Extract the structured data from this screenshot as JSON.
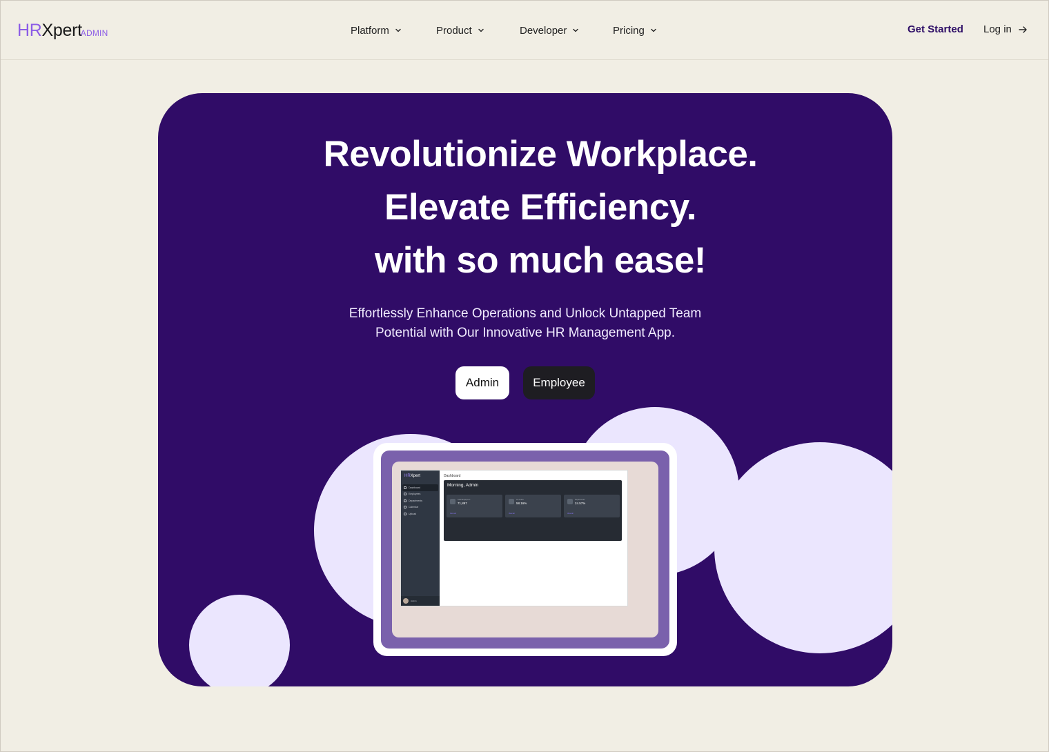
{
  "brand": {
    "hr": "HR",
    "xpert": "Xpert",
    "tag": "ADMIN"
  },
  "nav": [
    {
      "label": "Platform"
    },
    {
      "label": "Product"
    },
    {
      "label": "Developer"
    },
    {
      "label": "Pricing"
    }
  ],
  "header_actions": {
    "get_started": "Get Started",
    "login": "Log in"
  },
  "hero": {
    "headline": [
      "Revolutionize Workplace.",
      "Elevate Efficiency.",
      "with so much ease!"
    ],
    "subtext": [
      "Effortlessly Enhance Operations and Unlock Untapped Team",
      "Potential with Our Innovative HR Management App."
    ],
    "buttons": {
      "admin": "Admin",
      "employee": "Employee"
    }
  },
  "mockup": {
    "logo_hr": "HR",
    "logo_rest": "Xpert",
    "menu": [
      "Dashboard",
      "Employees",
      "Departments",
      "Calendar",
      "Upload"
    ],
    "user": "Admin",
    "page_title": "Dashboard",
    "greeting": "Morning, Admin",
    "cards": [
      {
        "label": "Total Employees",
        "value": "71,897",
        "link": "View all"
      },
      {
        "label": "On Leave",
        "value": "58.16%",
        "link": "View all"
      },
      {
        "label": "Departments",
        "value": "24.57%",
        "link": "View all"
      }
    ]
  },
  "colors": {
    "background": "#f1eee4",
    "hero": "#300c67",
    "accent": "#8c5ce6",
    "bubble": "#ebe6fe",
    "employee_button": "#1e1d22"
  }
}
